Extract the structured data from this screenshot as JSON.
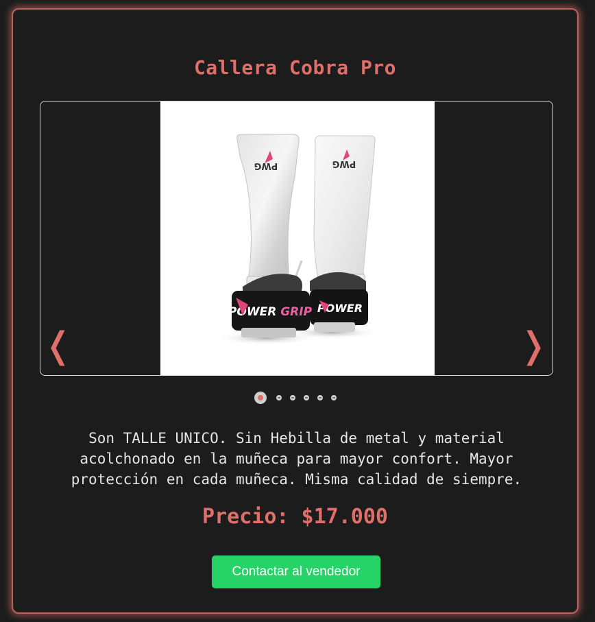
{
  "product": {
    "title": "Callera Cobra Pro",
    "image_alt": "Callera Cobra Pro",
    "description": "Son TALLE UNICO. Sin Hebilla de metal y material acolchonado en la muñeca para mayor confort. Mayor protección en cada muñeca. Misma calidad de siempre.",
    "price_text": "Precio: $17.000",
    "contact_label": "Contactar al vendedor",
    "brand_text_logo": "PWG",
    "strap_text": "POWER GRIP"
  },
  "carousel": {
    "prev_icon": "‹",
    "next_icon": "›",
    "prev_glyph": "❬",
    "next_glyph": "❭",
    "slide_count": 6,
    "active_index": 0
  },
  "colors": {
    "accent": "#e06e69",
    "background": "#1c1c1c",
    "button": "#25d366",
    "text": "#e6e6e6"
  }
}
